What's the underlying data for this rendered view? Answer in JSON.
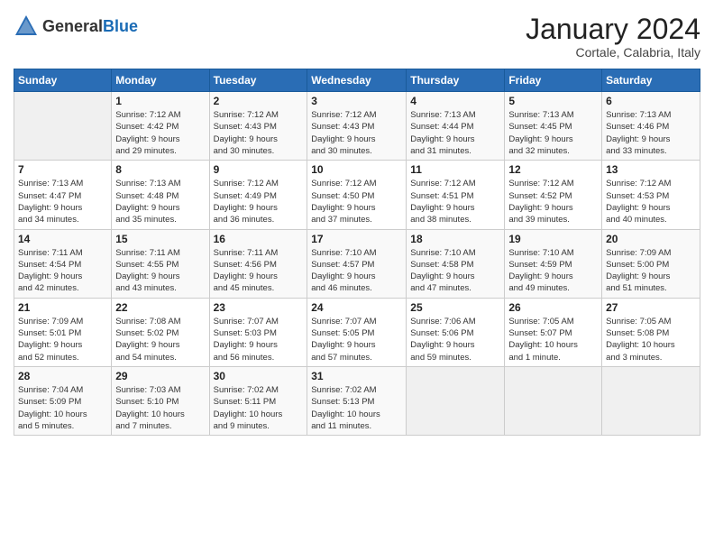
{
  "header": {
    "logo_general": "General",
    "logo_blue": "Blue",
    "month": "January 2024",
    "location": "Cortale, Calabria, Italy"
  },
  "weekdays": [
    "Sunday",
    "Monday",
    "Tuesday",
    "Wednesday",
    "Thursday",
    "Friday",
    "Saturday"
  ],
  "weeks": [
    [
      {
        "day": "",
        "info": ""
      },
      {
        "day": "1",
        "info": "Sunrise: 7:12 AM\nSunset: 4:42 PM\nDaylight: 9 hours\nand 29 minutes."
      },
      {
        "day": "2",
        "info": "Sunrise: 7:12 AM\nSunset: 4:43 PM\nDaylight: 9 hours\nand 30 minutes."
      },
      {
        "day": "3",
        "info": "Sunrise: 7:12 AM\nSunset: 4:43 PM\nDaylight: 9 hours\nand 30 minutes."
      },
      {
        "day": "4",
        "info": "Sunrise: 7:13 AM\nSunset: 4:44 PM\nDaylight: 9 hours\nand 31 minutes."
      },
      {
        "day": "5",
        "info": "Sunrise: 7:13 AM\nSunset: 4:45 PM\nDaylight: 9 hours\nand 32 minutes."
      },
      {
        "day": "6",
        "info": "Sunrise: 7:13 AM\nSunset: 4:46 PM\nDaylight: 9 hours\nand 33 minutes."
      }
    ],
    [
      {
        "day": "7",
        "info": "Sunrise: 7:13 AM\nSunset: 4:47 PM\nDaylight: 9 hours\nand 34 minutes."
      },
      {
        "day": "8",
        "info": "Sunrise: 7:13 AM\nSunset: 4:48 PM\nDaylight: 9 hours\nand 35 minutes."
      },
      {
        "day": "9",
        "info": "Sunrise: 7:12 AM\nSunset: 4:49 PM\nDaylight: 9 hours\nand 36 minutes."
      },
      {
        "day": "10",
        "info": "Sunrise: 7:12 AM\nSunset: 4:50 PM\nDaylight: 9 hours\nand 37 minutes."
      },
      {
        "day": "11",
        "info": "Sunrise: 7:12 AM\nSunset: 4:51 PM\nDaylight: 9 hours\nand 38 minutes."
      },
      {
        "day": "12",
        "info": "Sunrise: 7:12 AM\nSunset: 4:52 PM\nDaylight: 9 hours\nand 39 minutes."
      },
      {
        "day": "13",
        "info": "Sunrise: 7:12 AM\nSunset: 4:53 PM\nDaylight: 9 hours\nand 40 minutes."
      }
    ],
    [
      {
        "day": "14",
        "info": "Sunrise: 7:11 AM\nSunset: 4:54 PM\nDaylight: 9 hours\nand 42 minutes."
      },
      {
        "day": "15",
        "info": "Sunrise: 7:11 AM\nSunset: 4:55 PM\nDaylight: 9 hours\nand 43 minutes."
      },
      {
        "day": "16",
        "info": "Sunrise: 7:11 AM\nSunset: 4:56 PM\nDaylight: 9 hours\nand 45 minutes."
      },
      {
        "day": "17",
        "info": "Sunrise: 7:10 AM\nSunset: 4:57 PM\nDaylight: 9 hours\nand 46 minutes."
      },
      {
        "day": "18",
        "info": "Sunrise: 7:10 AM\nSunset: 4:58 PM\nDaylight: 9 hours\nand 47 minutes."
      },
      {
        "day": "19",
        "info": "Sunrise: 7:10 AM\nSunset: 4:59 PM\nDaylight: 9 hours\nand 49 minutes."
      },
      {
        "day": "20",
        "info": "Sunrise: 7:09 AM\nSunset: 5:00 PM\nDaylight: 9 hours\nand 51 minutes."
      }
    ],
    [
      {
        "day": "21",
        "info": "Sunrise: 7:09 AM\nSunset: 5:01 PM\nDaylight: 9 hours\nand 52 minutes."
      },
      {
        "day": "22",
        "info": "Sunrise: 7:08 AM\nSunset: 5:02 PM\nDaylight: 9 hours\nand 54 minutes."
      },
      {
        "day": "23",
        "info": "Sunrise: 7:07 AM\nSunset: 5:03 PM\nDaylight: 9 hours\nand 56 minutes."
      },
      {
        "day": "24",
        "info": "Sunrise: 7:07 AM\nSunset: 5:05 PM\nDaylight: 9 hours\nand 57 minutes."
      },
      {
        "day": "25",
        "info": "Sunrise: 7:06 AM\nSunset: 5:06 PM\nDaylight: 9 hours\nand 59 minutes."
      },
      {
        "day": "26",
        "info": "Sunrise: 7:05 AM\nSunset: 5:07 PM\nDaylight: 10 hours\nand 1 minute."
      },
      {
        "day": "27",
        "info": "Sunrise: 7:05 AM\nSunset: 5:08 PM\nDaylight: 10 hours\nand 3 minutes."
      }
    ],
    [
      {
        "day": "28",
        "info": "Sunrise: 7:04 AM\nSunset: 5:09 PM\nDaylight: 10 hours\nand 5 minutes."
      },
      {
        "day": "29",
        "info": "Sunrise: 7:03 AM\nSunset: 5:10 PM\nDaylight: 10 hours\nand 7 minutes."
      },
      {
        "day": "30",
        "info": "Sunrise: 7:02 AM\nSunset: 5:11 PM\nDaylight: 10 hours\nand 9 minutes."
      },
      {
        "day": "31",
        "info": "Sunrise: 7:02 AM\nSunset: 5:13 PM\nDaylight: 10 hours\nand 11 minutes."
      },
      {
        "day": "",
        "info": ""
      },
      {
        "day": "",
        "info": ""
      },
      {
        "day": "",
        "info": ""
      }
    ]
  ]
}
